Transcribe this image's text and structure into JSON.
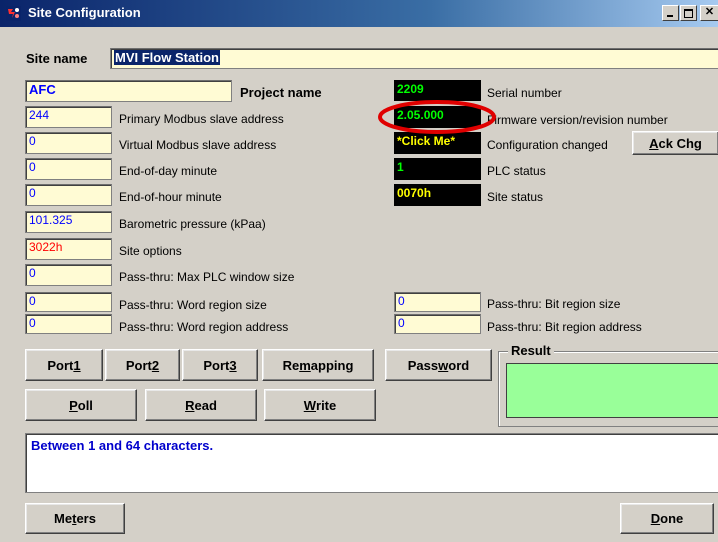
{
  "window": {
    "title": "Site Configuration"
  },
  "site_name": {
    "label": "Site name",
    "value": "MVI Flow Station"
  },
  "project": {
    "value": "AFC",
    "label": "Project name"
  },
  "left_fields": [
    {
      "value": "244",
      "label": "Primary Modbus slave address",
      "color": "#0000ff"
    },
    {
      "value": "0",
      "label": "Virtual Modbus slave address",
      "color": "#0000ff"
    },
    {
      "value": "0",
      "label": "End-of-day minute",
      "color": "#0000ff"
    },
    {
      "value": "0",
      "label": "End-of-hour minute",
      "color": "#0000ff"
    },
    {
      "value": "101.325",
      "label": "Barometric pressure (kPaa)",
      "color": "#0000ff"
    },
    {
      "value": "3022h",
      "label": "Site options",
      "color": "#ff0000"
    },
    {
      "value": "0",
      "label": "Pass-thru: Max PLC window size",
      "color": "#0000ff"
    },
    {
      "value": "0",
      "label": "Pass-thru: Word region size",
      "color": "#0000ff"
    },
    {
      "value": "0",
      "label": "Pass-thru: Word region address",
      "color": "#0000ff"
    }
  ],
  "status": {
    "serial": {
      "value": "2209",
      "label": "Serial number",
      "color": "#00ff00"
    },
    "firmware": {
      "value": "2.05.000",
      "label": "Firmware version/revision number",
      "color": "#00ff00"
    },
    "config_changed": {
      "value": "*Click Me*",
      "label": "Configuration changed",
      "color": "#ffff00"
    },
    "plc_status": {
      "value": "1",
      "label": "PLC status",
      "color": "#00ff00"
    },
    "site_status": {
      "value": "0070h",
      "label": "Site status",
      "color": "#ffff00"
    }
  },
  "ack_button": {
    "pre": "",
    "key": "A",
    "post": "ck Chg"
  },
  "bit_fields": [
    {
      "value": "0",
      "label": "Pass-thru: Bit region size"
    },
    {
      "value": "0",
      "label": "Pass-thru: Bit region address"
    }
  ],
  "buttons": {
    "port1": {
      "pre": "Port ",
      "key": "1",
      "post": ""
    },
    "port2": {
      "pre": "Port ",
      "key": "2",
      "post": ""
    },
    "port3": {
      "pre": "Port ",
      "key": "3",
      "post": ""
    },
    "remapping": {
      "pre": "Re",
      "key": "m",
      "post": "apping"
    },
    "password": {
      "pre": "Pass",
      "key": "w",
      "post": "ord"
    },
    "poll": {
      "pre": "",
      "key": "P",
      "post": "oll"
    },
    "read": {
      "pre": "",
      "key": "R",
      "post": "ead"
    },
    "write": {
      "pre": "",
      "key": "W",
      "post": "rite"
    },
    "meters": {
      "pre": "Me",
      "key": "t",
      "post": "ers"
    },
    "done": {
      "pre": "",
      "key": "D",
      "post": "one"
    }
  },
  "result": {
    "label": "Result",
    "color": "#99ff99"
  },
  "message": {
    "text": "Between 1 and 64 characters."
  },
  "annotation": {
    "color": "#e00000"
  }
}
